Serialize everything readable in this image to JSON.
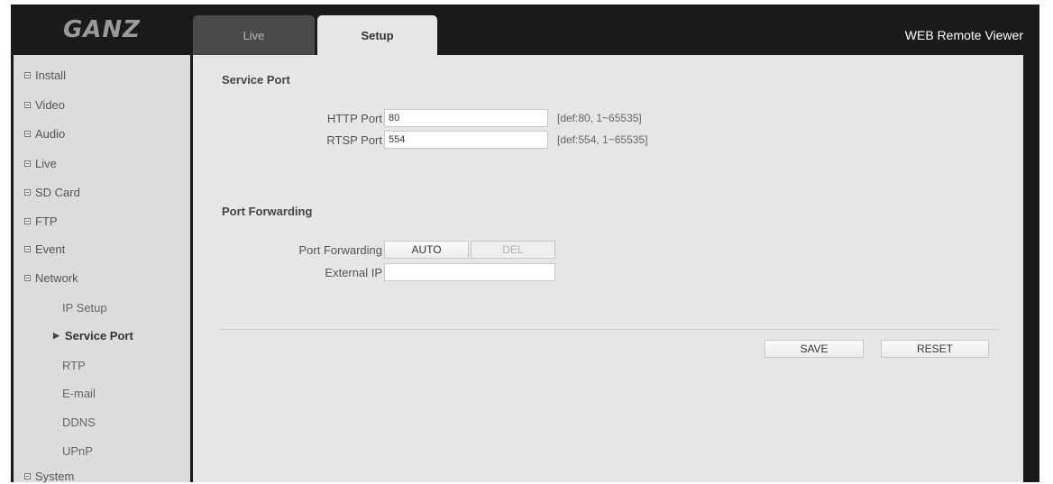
{
  "header": {
    "logo_text": "GANZ",
    "tabs": [
      {
        "label": "Live",
        "active": false
      },
      {
        "label": "Setup",
        "active": true
      }
    ],
    "viewer_title": "WEB Remote Viewer"
  },
  "sidebar": {
    "items": [
      {
        "label": "Install"
      },
      {
        "label": "Video"
      },
      {
        "label": "Audio"
      },
      {
        "label": "Live"
      },
      {
        "label": "SD Card"
      },
      {
        "label": "FTP"
      },
      {
        "label": "Event"
      },
      {
        "label": "Network"
      }
    ],
    "network_subitems": [
      {
        "label": "IP Setup"
      },
      {
        "label": "Service Port",
        "active": true
      },
      {
        "label": "RTP"
      },
      {
        "label": "E-mail"
      },
      {
        "label": "DDNS"
      },
      {
        "label": "UPnP"
      }
    ],
    "system": {
      "label": "System"
    }
  },
  "service_port": {
    "title": "Service Port",
    "http": {
      "label": "HTTP Port",
      "value": "80",
      "hint": "[def:80, 1~65535]"
    },
    "rtsp": {
      "label": "RTSP Port",
      "value": "554",
      "hint": "[def:554, 1~65535]"
    }
  },
  "port_forwarding": {
    "title": "Port Forwarding",
    "label": "Port Forwarding",
    "auto_button": "AUTO",
    "del_button": "DEL",
    "external_ip_label": "External IP",
    "external_ip_value": ""
  },
  "actions": {
    "save": "SAVE",
    "reset": "RESET"
  },
  "colors": {
    "frame_bg": "#1a1a1a",
    "content_bg": "#e6e6e6",
    "sidebar_bg": "#dcdcdc"
  }
}
